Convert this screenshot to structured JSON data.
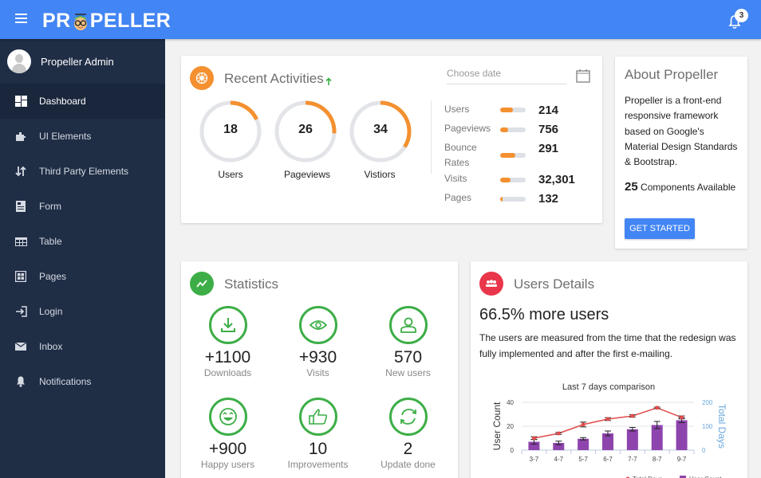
{
  "header": {
    "brand": "PROPELLER",
    "brand_pre": "PR",
    "brand_post": "PELLER",
    "notification_count": "3",
    "accent_color": "#4285f4"
  },
  "sidebar": {
    "user_name": "Propeller Admin",
    "items": [
      {
        "label": "Dashboard",
        "icon": "dashboard-icon",
        "active": true
      },
      {
        "label": "UI Elements",
        "icon": "puzzle-icon",
        "active": false
      },
      {
        "label": "Third Party Elements",
        "icon": "swap-icon",
        "active": false
      },
      {
        "label": "Form",
        "icon": "form-icon",
        "active": false
      },
      {
        "label": "Table",
        "icon": "table-icon",
        "active": false
      },
      {
        "label": "Pages",
        "icon": "pages-icon",
        "active": false
      },
      {
        "label": "Login",
        "icon": "login-icon",
        "active": false
      },
      {
        "label": "Inbox",
        "icon": "mail-icon",
        "active": false
      },
      {
        "label": "Notifications",
        "icon": "bell-icon",
        "active": false
      }
    ]
  },
  "recent_activities": {
    "title": "Recent Activities",
    "trend_icon": "arrow-up-icon",
    "date_placeholder": "Choose date",
    "rings": [
      {
        "value": "18",
        "label": "Users",
        "percent": 18
      },
      {
        "value": "26",
        "label": "Pageviews",
        "percent": 26
      },
      {
        "value": "34",
        "label": "Vistiors",
        "percent": 34
      }
    ],
    "stats": [
      {
        "label": "Users",
        "value": "214",
        "percent": 50
      },
      {
        "label": "Pageviews",
        "value": "756",
        "percent": 30
      },
      {
        "label": "Bounce Rates",
        "value": "291",
        "percent": 60
      },
      {
        "label": "Visits",
        "value": "32,301",
        "percent": 40
      },
      {
        "label": "Pages",
        "value": "132",
        "percent": 10
      }
    ]
  },
  "about": {
    "title": "About Propeller",
    "text": "Propeller is a front-end responsive framework based on Google's Material Design Standards & Bootstrap.",
    "count": "25",
    "count_label": "Components Available",
    "button": "GET STARTED"
  },
  "statistics": {
    "title": "Statistics",
    "items": [
      {
        "value": "+1100",
        "label": "Downloads",
        "icon": "download-icon"
      },
      {
        "value": "+930",
        "label": "Visits",
        "icon": "eye-icon"
      },
      {
        "value": "570",
        "label": "New users",
        "icon": "user-icon"
      },
      {
        "value": "+900",
        "label": "Happy users",
        "icon": "smiley-icon"
      },
      {
        "value": "10",
        "label": "Improvements",
        "icon": "thumbs-up-icon"
      },
      {
        "value": "2",
        "label": "Update done",
        "icon": "refresh-icon"
      }
    ]
  },
  "users_details": {
    "title": "Users Details",
    "headline": "66.5% more users",
    "text": "The users are measured from the time that the redesign was fully implemented and after the first e-mailing."
  },
  "chart_data": {
    "type": "bar",
    "title": "Last 7 days comparison",
    "categories": [
      "3-7",
      "4-7",
      "5-7",
      "6-7",
      "7-7",
      "8-7",
      "9-7"
    ],
    "series": [
      {
        "name": "User Count",
        "type": "bar",
        "axis": "left",
        "color": "#8e44ad",
        "values": [
          7,
          6,
          9.5,
          14,
          17.5,
          21,
          25
        ],
        "error": [
          2,
          1.5,
          1,
          2,
          1.5,
          3,
          2
        ]
      },
      {
        "name": "Total Days",
        "type": "line",
        "axis": "right",
        "color": "#e14c4c",
        "values": [
          50,
          70,
          107,
          130,
          143,
          177,
          137
        ],
        "error": [
          6,
          4,
          10,
          6,
          5,
          3,
          6
        ]
      }
    ],
    "ylabel": "User Count",
    "ylabel_right": "Total Days",
    "ylim": [
      0,
      40
    ],
    "ylim_right": [
      0,
      200
    ],
    "yticks": [
      "0",
      "20",
      "40"
    ],
    "yticks_right": [
      "0",
      "100",
      "200"
    ],
    "grid": true,
    "legend": "bottom-right"
  }
}
